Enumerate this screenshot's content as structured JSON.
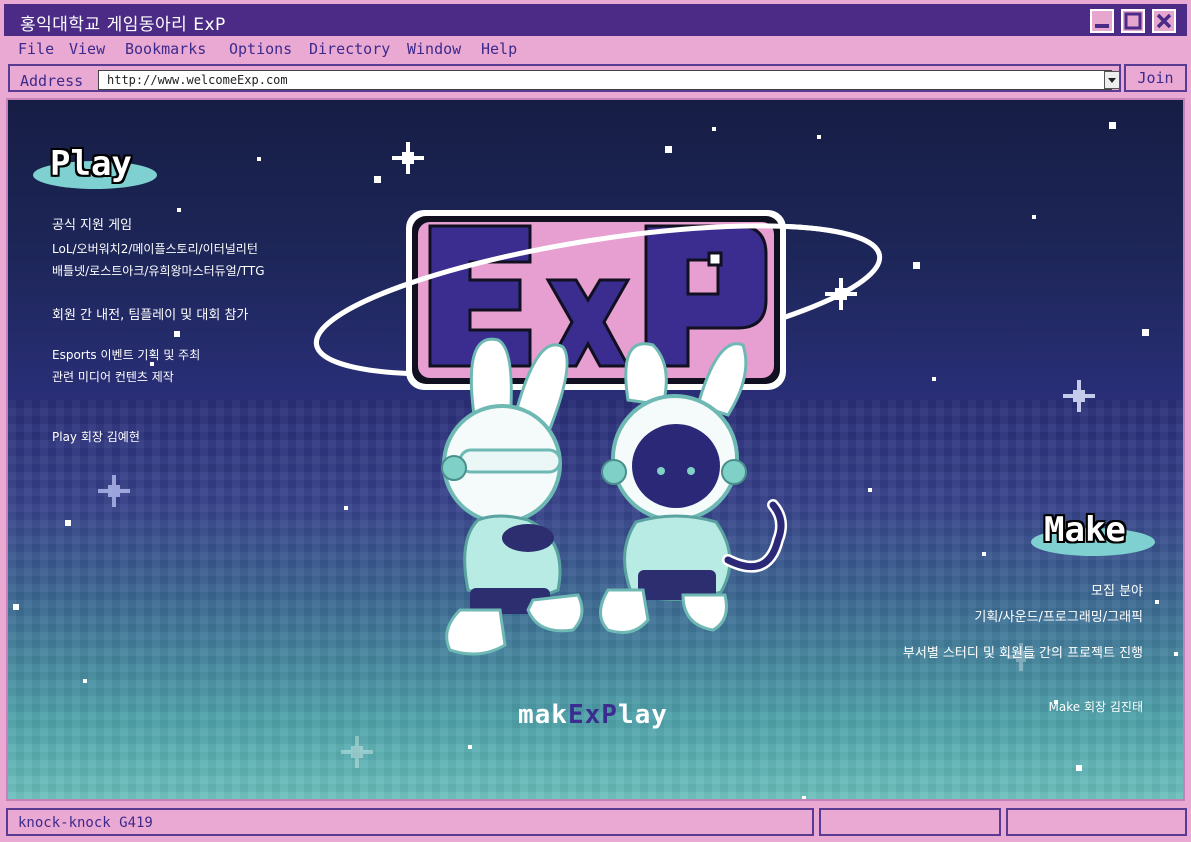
{
  "window": {
    "title": "홍익대학교 게임동아리 ExP"
  },
  "menu": [
    "File",
    "View",
    "Bookmarks",
    "Options",
    "Directory",
    "Window",
    "Help"
  ],
  "address": {
    "label": "Address",
    "url": "http://www.welcomeExp.com",
    "join_label": "Join"
  },
  "play": {
    "heading": "Play",
    "lines": [
      "공식 지원 게임",
      "LoL/오버워치2/메이플스토리/이터널리턴",
      "배틀넷/로스트아크/유희왕마스터듀얼/TTG",
      "회원 간 내전, 팀플레이 및 대회 참가",
      "Esports 이벤트 기획 및 주최",
      "관련 미디어 컨텐츠 제작",
      "Play 회장 김예현"
    ]
  },
  "make": {
    "heading": "Make",
    "lines": [
      "모집 분야",
      "기획/사운드/프로그래밍/그래픽",
      "부서별 스터디 및 회원들 간의 프로젝트 진행",
      "Make 회장 김진태"
    ]
  },
  "logo": {
    "text": "ExP"
  },
  "tagline": {
    "pre": "mak",
    "mid": "ExP",
    "post": "lay"
  },
  "status": {
    "text": "knock-knock G419"
  },
  "colors": {
    "title_bar": "#4b2b86",
    "chrome": "#e9a9d2",
    "accent_text": "#3d2a8c",
    "logo_fill": "#3b2d8f",
    "logo_outline": "#e79ed0",
    "badge": "#7fd0d0"
  },
  "icons": [
    "minimize-icon",
    "maximize-icon",
    "close-icon",
    "dropdown-arrow-icon",
    "sparkle-star-icon"
  ]
}
